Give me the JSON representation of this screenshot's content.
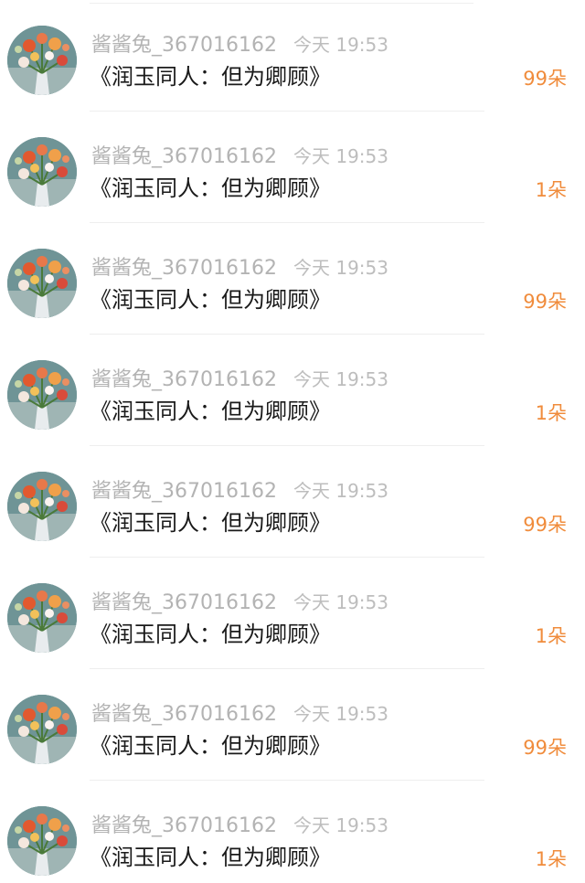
{
  "gifts": [
    {
      "username": "酱酱兔_367016162",
      "time": "今天 19:53",
      "book_title": "《润玉同人：但为卿顾》",
      "amount": "99朵"
    },
    {
      "username": "酱酱兔_367016162",
      "time": "今天 19:53",
      "book_title": "《润玉同人：但为卿顾》",
      "amount": "1朵"
    },
    {
      "username": "酱酱兔_367016162",
      "time": "今天 19:53",
      "book_title": "《润玉同人：但为卿顾》",
      "amount": "99朵"
    },
    {
      "username": "酱酱兔_367016162",
      "time": "今天 19:53",
      "book_title": "《润玉同人：但为卿顾》",
      "amount": "1朵"
    },
    {
      "username": "酱酱兔_367016162",
      "time": "今天 19:53",
      "book_title": "《润玉同人：但为卿顾》",
      "amount": "99朵"
    },
    {
      "username": "酱酱兔_367016162",
      "time": "今天 19:53",
      "book_title": "《润玉同人：但为卿顾》",
      "amount": "1朵"
    },
    {
      "username": "酱酱兔_367016162",
      "time": "今天 19:53",
      "book_title": "《润玉同人：但为卿顾》",
      "amount": "99朵"
    },
    {
      "username": "酱酱兔_367016162",
      "time": "今天 19:53",
      "book_title": "《润玉同人：但为卿顾》",
      "amount": "1朵"
    }
  ],
  "colors": {
    "amount": "#f08c3c",
    "meta_text": "#b3b3b3",
    "title_text": "#1a1a1a"
  }
}
